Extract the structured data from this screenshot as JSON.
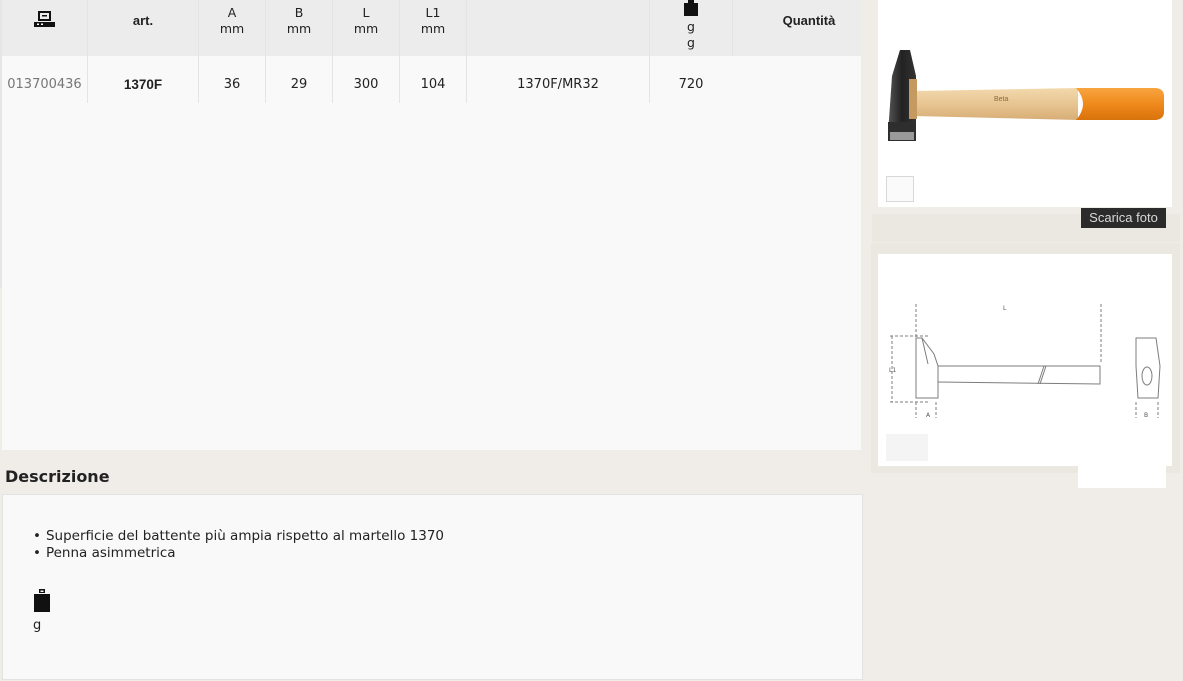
{
  "table": {
    "headers": {
      "art": "art.",
      "a": {
        "label": "A",
        "unit": "mm"
      },
      "b": {
        "label": "B",
        "unit": "mm"
      },
      "l": {
        "label": "L",
        "unit": "mm"
      },
      "l1": {
        "label": "L1",
        "unit": "mm"
      },
      "weight": {
        "unit1": "g",
        "unit2": "g"
      },
      "quantity": "Quantità"
    },
    "rows": [
      {
        "code": "013700436",
        "art": "1370F",
        "a": "36",
        "b": "29",
        "l": "300",
        "l1": "104",
        "ref": "1370F/MR32",
        "weight": "720"
      }
    ]
  },
  "description": {
    "title": "Descrizione",
    "items": [
      "Superficie del battente più ampia rispetto al martello 1370",
      "Penna asimmetrica"
    ],
    "weight_unit": "g"
  },
  "photo": {
    "download_label": "Scarica foto",
    "logo_text": "Beta"
  },
  "drawing": {
    "labels": {
      "l": "L",
      "l1": "L1",
      "a": "A",
      "b": "B"
    }
  },
  "icons": {
    "catalog": "catalog-code-icon",
    "weight": "weight-icon"
  },
  "colors": {
    "handle_orange": "#f08a1c",
    "button_bg": "#2b2b2b",
    "page_bg": "#f0ede8"
  }
}
